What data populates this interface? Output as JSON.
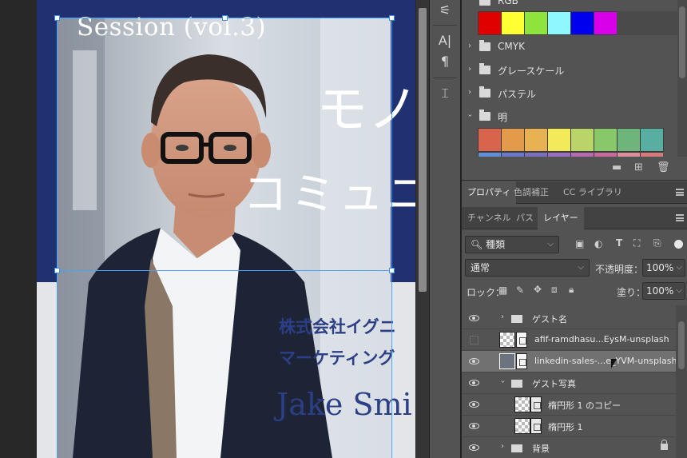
{
  "document": {
    "session_title": "Session (vol.3)",
    "catch_line1": "モノ",
    "catch_line2": "コミュニ",
    "company": "株式会社イグニ",
    "department": "マーケティング",
    "person_name": "Jake Smi",
    "colors": {
      "navy": "#1f3170",
      "light": "#e4e5e9",
      "text_blue": "#2c3f86"
    }
  },
  "tools": {
    "items": [
      "adjust-icon",
      "character-icon",
      "paragraph-icon",
      "glyph-icon"
    ],
    "glyphs": {
      "adjust": "⚟",
      "character": "A|",
      "paragraph": "¶",
      "glyph": "⌶"
    }
  },
  "swatches": {
    "groups": [
      {
        "label": "RGB",
        "expanded": true,
        "colors": [
          "#e00000",
          "#ffff33",
          "#8fe33d",
          "#8ff7ff",
          "#0000ee",
          "#d800e8"
        ]
      },
      {
        "label": "CMYK",
        "expanded": false
      },
      {
        "label": "グレースケール",
        "expanded": false
      },
      {
        "label": "パステル",
        "expanded": false
      },
      {
        "label": "明",
        "expanded": true,
        "colors": [
          "#d9644d",
          "#e39a4a",
          "#e8b252",
          "#f3ea5a",
          "#b9d467",
          "#88c76a",
          "#6db57b",
          "#59aea2"
        ]
      }
    ]
  },
  "panel_tabs": {
    "top": [
      "プロパティ",
      "色調補正",
      "CC ライブラリ"
    ],
    "layers": [
      "チャンネル",
      "パス",
      "レイヤー"
    ]
  },
  "layer_controls": {
    "filter_kind": "種類",
    "blend_mode": "通常",
    "opacity_label": "不透明度：",
    "opacity_value": "100%",
    "lock_label": "ロック：",
    "fill_label": "塗り：",
    "fill_value": "100%"
  },
  "layers": [
    {
      "name": "ゲスト名",
      "type": "group",
      "visible": true,
      "indent": 1
    },
    {
      "name": "afif-ramdhasu...EysM-unsplash",
      "type": "image",
      "visible": false,
      "indent": 1
    },
    {
      "name": "linkedin-sales-...e_YVM-unsplash",
      "type": "smart",
      "visible": true,
      "indent": 1,
      "selected": true
    },
    {
      "name": "ゲスト写真",
      "type": "group",
      "visible": true,
      "indent": 1,
      "expanded": true
    },
    {
      "name": "楕円形 1 のコピー",
      "type": "shape",
      "visible": true,
      "indent": 2
    },
    {
      "name": "楕円形 1",
      "type": "shape",
      "visible": true,
      "indent": 2
    },
    {
      "name": "背景",
      "type": "group",
      "visible": true,
      "indent": 1,
      "locked": true
    }
  ]
}
